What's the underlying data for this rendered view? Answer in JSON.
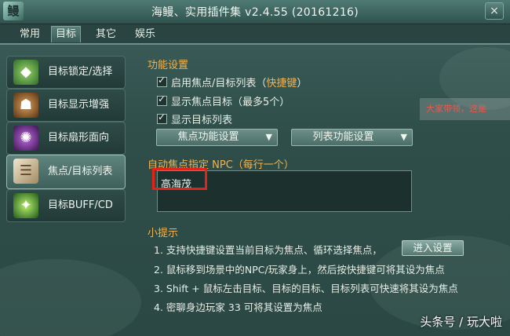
{
  "window": {
    "title": "海鳗、实用插件集 v2.4.55 (20161216)",
    "close_label": "×",
    "logo_glyph": "鳗"
  },
  "tabs": [
    {
      "label": "常用",
      "active": false
    },
    {
      "label": "目标",
      "active": true
    },
    {
      "label": "其它",
      "active": false
    },
    {
      "label": "娱乐",
      "active": false
    }
  ],
  "sidebar": {
    "items": [
      {
        "label": "目标锁定/选择",
        "icon": "target-lock-icon",
        "active": false
      },
      {
        "label": "目标显示增强",
        "icon": "warrior-portrait-icon",
        "active": false
      },
      {
        "label": "目标扇形面向",
        "icon": "sector-facing-icon",
        "active": false
      },
      {
        "label": "焦点/目标列表",
        "icon": "scroll-list-icon",
        "active": true
      },
      {
        "label": "目标BUFF/CD",
        "icon": "buff-figure-icon",
        "active": false
      }
    ]
  },
  "settings": {
    "section_title": "功能设置",
    "options": [
      {
        "label": "启用焦点/目标列表（",
        "hotkey": "快捷键",
        "suffix": "）",
        "checked": true
      },
      {
        "label": "显示焦点目标（最多5个）",
        "checked": true
      },
      {
        "label": "显示目标列表",
        "checked": true
      }
    ],
    "dropdowns": [
      {
        "label": "焦点功能设置"
      },
      {
        "label": "列表功能设置"
      }
    ]
  },
  "auto_focus": {
    "section_title": "自动焦点指定 NPC（每行一个）",
    "value": "高海茂"
  },
  "tips": {
    "title": "小提示",
    "lines": [
      "1. 支持快捷键设置当前目标为焦点、循环选择焦点，",
      "2. 鼠标移到场景中的NPC/玩家身上，然后按快捷键可将其设为焦点",
      "3. Shift + 鼠标左击目标、目标的目标、目标列表可快速将其设为焦点",
      "4. 密聊身边玩家 33 可将其设置为焦点"
    ],
    "button_label": "进入设置"
  },
  "background": {
    "window_text": "大家带领，这是"
  },
  "watermark": "头条号 / 玩大啦",
  "colors": {
    "accent": "#f6b24a",
    "highlight_box": "#e2231a"
  }
}
